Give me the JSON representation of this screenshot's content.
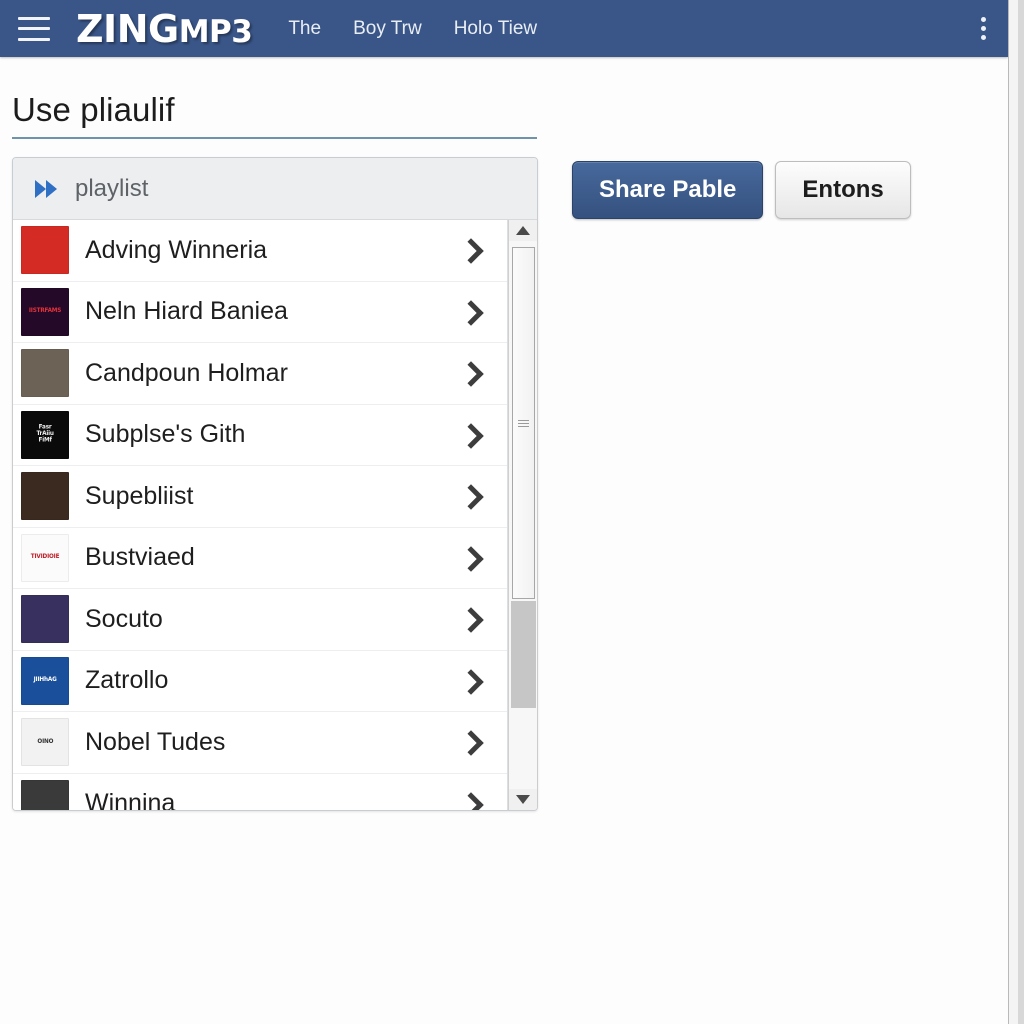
{
  "topbar": {
    "menu_icon": "hamburger-icon",
    "brand_primary": "ZING",
    "brand_secondary": "MP3",
    "nav_items": [
      {
        "label": "The"
      },
      {
        "label": "Boy Trw"
      },
      {
        "label": "Holo Tiew"
      }
    ],
    "overflow_icon": "kebab-menu-icon",
    "background_color": "#3a5688"
  },
  "page": {
    "title": "Use pliaulif",
    "title_underline_color": "#6f93ab"
  },
  "playlist": {
    "header_icon": "fast-forward-icon",
    "header_label": "playlist",
    "items": [
      {
        "title": "Adving Winneria",
        "thumb_label": "",
        "thumb_bg": "#d42b25",
        "thumb_fg": "#ffffff"
      },
      {
        "title": "Neln Hiard Baniea",
        "thumb_label": "IISTRFAMS",
        "thumb_bg": "#240a28",
        "thumb_fg": "#e2313a"
      },
      {
        "title": "Candpoun Holmar",
        "thumb_label": "",
        "thumb_bg": "#6d6256",
        "thumb_fg": "#ffffff"
      },
      {
        "title": "Subplse's Gith",
        "thumb_label": "Fasr\nTrAiiu\nFiMf",
        "thumb_bg": "#0a0a0a",
        "thumb_fg": "#f0f0f0"
      },
      {
        "title": "Supebliist",
        "thumb_label": "",
        "thumb_bg": "#3b2a20",
        "thumb_fg": "#ffffff"
      },
      {
        "title": "Bustviaed",
        "thumb_label": "TIVIDIOIE",
        "thumb_bg": "#fbfbfb",
        "thumb_fg": "#c01f28"
      },
      {
        "title": "Socuto",
        "thumb_label": "",
        "thumb_bg": "#38305e",
        "thumb_fg": "#ffffff"
      },
      {
        "title": "Zatrollo",
        "thumb_label": "JIIHhAG",
        "thumb_bg": "#1a4f9c",
        "thumb_fg": "#ffffff"
      },
      {
        "title": "Nobel Tudes",
        "thumb_label": "OINO",
        "thumb_bg": "#f2f2f2",
        "thumb_fg": "#333333"
      },
      {
        "title": "Winnina",
        "thumb_label": "",
        "thumb_bg": "#3a3a3a",
        "thumb_fg": "#ffffff"
      }
    ],
    "row_chevron_icon": "chevron-right-icon",
    "scrollbar": {
      "up_icon": "scroll-up-arrow-icon",
      "down_icon": "scroll-down-arrow-icon",
      "grip_icon": "scroll-thumb-grip-icon"
    }
  },
  "actions": {
    "primary_label": "Share Pable",
    "primary_color": "#3c5f8e",
    "secondary_label": "Entons",
    "secondary_color": "#eaeaea"
  }
}
